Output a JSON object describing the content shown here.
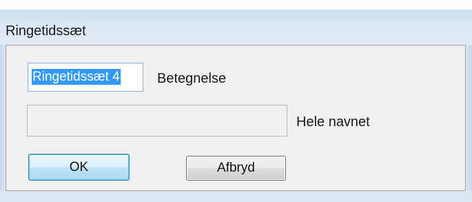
{
  "window": {
    "title": "Ringetidssæt"
  },
  "form": {
    "name_value": "Ringetidssæt 4",
    "name_label": "Betegnelse",
    "fullname_value": "",
    "fullname_label": "Hele navnet"
  },
  "buttons": {
    "ok_label": "OK",
    "cancel_label": "Afbryd"
  }
}
